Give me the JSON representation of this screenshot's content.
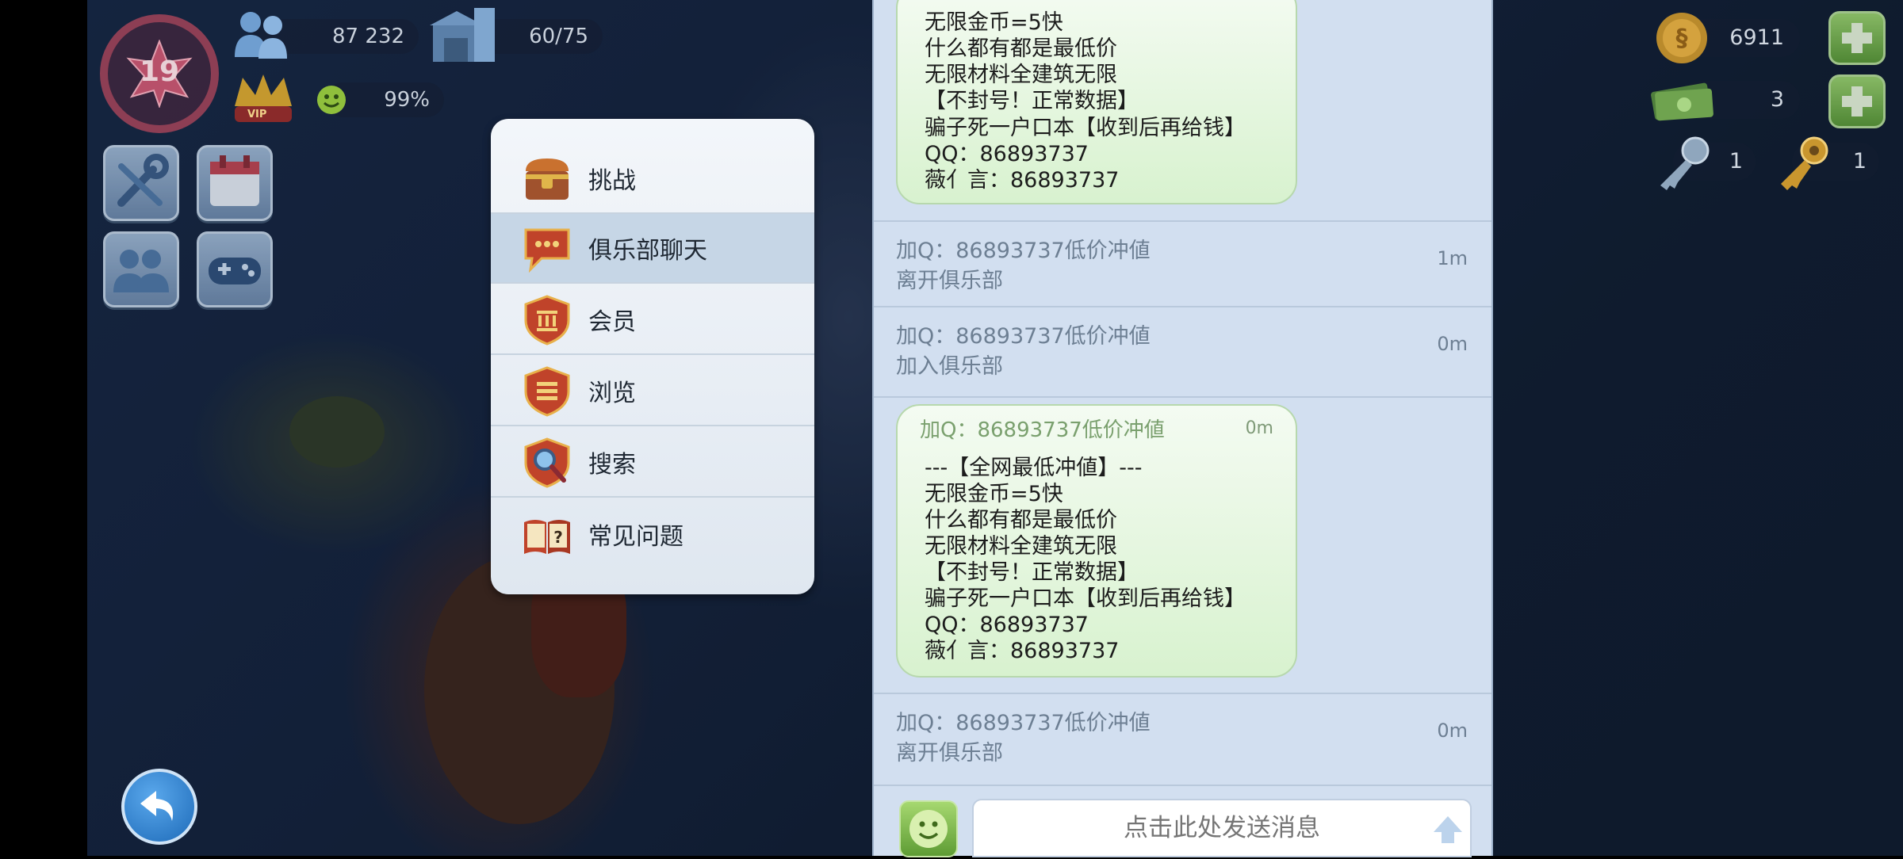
{
  "hud": {
    "level": "19",
    "population": "87 232",
    "storage": "60/75",
    "happiness": "99%",
    "vip_badge": "VIP"
  },
  "resources": {
    "simoleons": "6911",
    "simcash": "3",
    "platinum_keys": "1",
    "golden_keys": "1"
  },
  "menu": {
    "items": [
      {
        "label": "挑战",
        "icon": "treasure-chest-icon"
      },
      {
        "label": "俱乐部聊天",
        "icon": "chat-bubble-icon",
        "active": true
      },
      {
        "label": "会员",
        "icon": "bank-shield-icon"
      },
      {
        "label": "浏览",
        "icon": "list-shield-icon"
      },
      {
        "label": "搜索",
        "icon": "magnifier-shield-icon"
      },
      {
        "label": "常见问题",
        "icon": "faq-book-icon"
      }
    ]
  },
  "chat": {
    "top_bubble_lines": [
      "无限金币=5快",
      "什么都有都是最低价",
      "无限材料全建筑无限",
      "【不封号！正常数据】",
      "骗子死一户口本【收到后再给钱】",
      "QQ：86893737",
      "薇亻言：86893737"
    ],
    "events": [
      {
        "name": "加Q：86893737低价冲値",
        "action": "离开俱乐部",
        "time": "1m"
      },
      {
        "name": "加Q：86893737低价冲値",
        "action": "加入俱乐部",
        "time": "0m"
      }
    ],
    "bubble": {
      "sender": "加Q：86893737低价冲値",
      "time": "0m",
      "lines": [
        "---【全网最低冲値】---",
        "无限金币=5快",
        "什么都有都是最低价",
        "无限材料全建筑无限",
        "【不封号！正常数据】",
        "骗子死一户口本【收到后再给钱】",
        "QQ：86893737",
        "薇亻言：86893737"
      ]
    },
    "last_event": {
      "name": "加Q：86893737低价冲値",
      "action": "离开俱乐部",
      "time": "0m"
    },
    "input_placeholder": "点击此处发送消息"
  },
  "colors": {
    "chat_bg": "#d2dff0",
    "bubble_green": "#d8f2cf",
    "plus_green": "#5b9a36",
    "menu_bg": "#eef2f7"
  }
}
